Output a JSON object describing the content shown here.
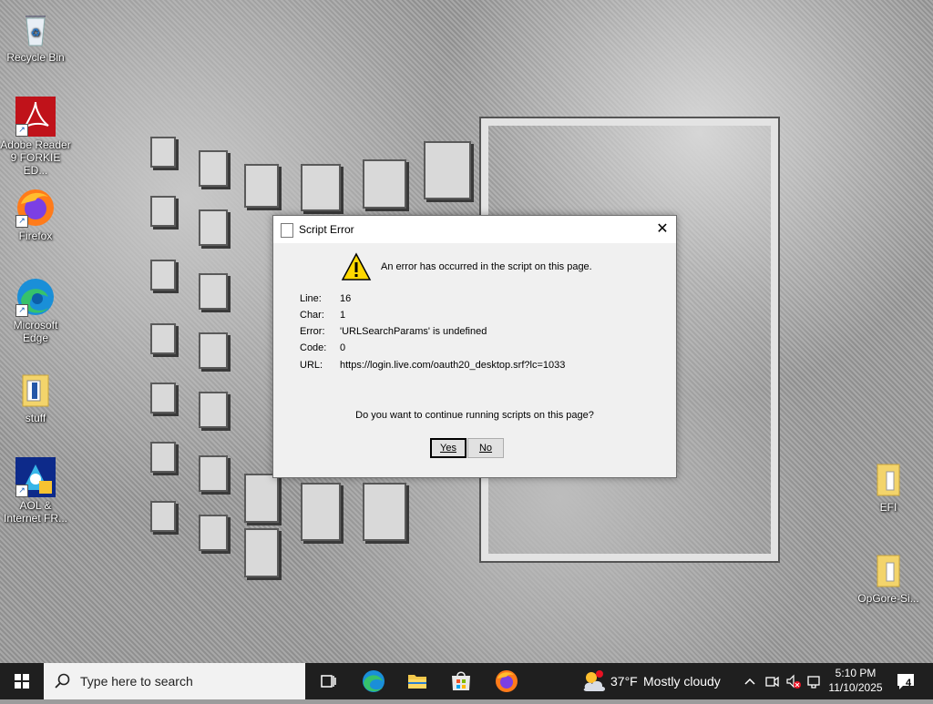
{
  "desktop": {
    "icons": [
      {
        "label": "Recycle Bin"
      },
      {
        "label": "Adobe Reader 9 FORKIE ED..."
      },
      {
        "label": "Firefox"
      },
      {
        "label": "Microsoft Edge"
      },
      {
        "label": "stuff"
      },
      {
        "label": "AOL & Internet FR..."
      },
      {
        "label": "EFI"
      },
      {
        "label": "OpGore-Si..."
      }
    ]
  },
  "dialog": {
    "title": "Script Error",
    "close_label": "✕",
    "message": "An error has occurred in the script on this page.",
    "fields": [
      {
        "key": "Line:",
        "value": "16"
      },
      {
        "key": "Char:",
        "value": "1"
      },
      {
        "key": "Error:",
        "value": "'URLSearchParams' is undefined"
      },
      {
        "key": "Code:",
        "value": "0"
      },
      {
        "key": "URL:",
        "value": "https://login.live.com/oauth20_desktop.srf?lc=1033"
      }
    ],
    "question": "Do you want to continue running scripts on this page?",
    "yes_label": "Yes",
    "no_label": "No"
  },
  "taskbar": {
    "search_placeholder": "Type here to search",
    "weather_temp": "37°F",
    "weather_condition": "Mostly cloudy",
    "time": "5:10 PM",
    "date": "11/10/2025",
    "notification_count": "4"
  },
  "colors": {
    "taskbar_bg": "#1f1f1f",
    "dialog_bg": "#f0f0f0",
    "warning": "#ffd800",
    "start_accent": "#ffffff"
  }
}
